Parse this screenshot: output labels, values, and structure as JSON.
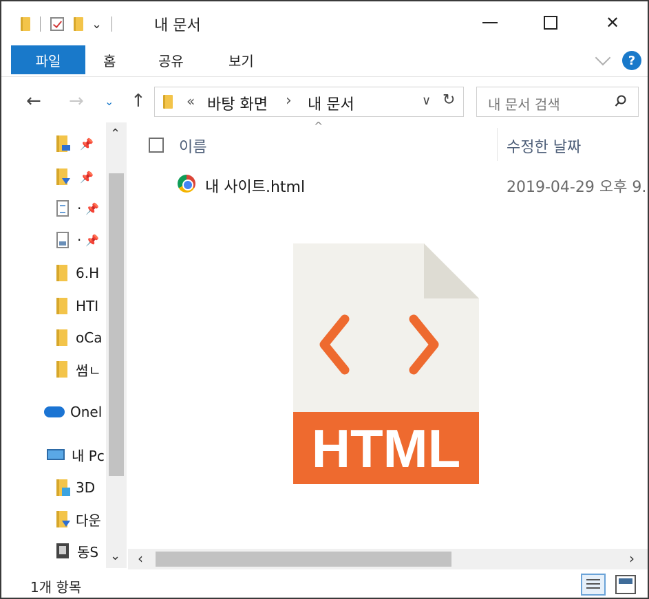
{
  "window": {
    "title": "내 문서",
    "minimize": "",
    "maximize": "",
    "close": "✕"
  },
  "ribbon": {
    "file_tab": "파일",
    "tabs": [
      "홈",
      "공유",
      "보기"
    ],
    "help": "?"
  },
  "nav": {
    "back": "←",
    "forward": "→",
    "recent": "⌄",
    "up": "↑"
  },
  "address": {
    "overflow": "«",
    "crumbs": [
      "바탕 화면",
      "내 문서"
    ],
    "separator": "›",
    "dropdown": "∨",
    "refresh": "↻"
  },
  "search": {
    "placeholder": "내 문서 검색"
  },
  "sidebar": {
    "items": [
      {
        "label": "",
        "icon": "desktop-folder-icon",
        "pinned": true
      },
      {
        "label": "",
        "icon": "downloads-folder-icon",
        "pinned": true
      },
      {
        "label": "·",
        "icon": "documents-icon",
        "pinned": true
      },
      {
        "label": "·",
        "icon": "pictures-icon",
        "pinned": true
      },
      {
        "label": "6.H",
        "icon": "folder-icon"
      },
      {
        "label": "HTI",
        "icon": "folder-icon"
      },
      {
        "label": "oCa",
        "icon": "folder-icon"
      },
      {
        "label": "썸ㄴ",
        "icon": "folder-icon"
      },
      {
        "label": "Onel",
        "icon": "onedrive-icon"
      },
      {
        "label": "내 Pc",
        "icon": "pc-icon"
      },
      {
        "label": "3D",
        "icon": "3d-objects-icon"
      },
      {
        "label": "다운",
        "icon": "downloads-folder-icon"
      },
      {
        "label": "동S",
        "icon": "videos-icon"
      }
    ],
    "pin_glyph": "📌"
  },
  "columns": {
    "sort_indicator": "^",
    "name": "이름",
    "date": "수정한 날짜"
  },
  "files": [
    {
      "name": "내 사이트.html",
      "date": "2019-04-29 오후 9..",
      "icon": "chrome-icon"
    }
  ],
  "overlay": {
    "code_glyph": "< >",
    "label": "HTML",
    "accent": "#ee6a2f",
    "page_color": "#f2f1ec"
  },
  "status": {
    "count": "1개 항목"
  },
  "colors": {
    "accent": "#1979ca"
  }
}
